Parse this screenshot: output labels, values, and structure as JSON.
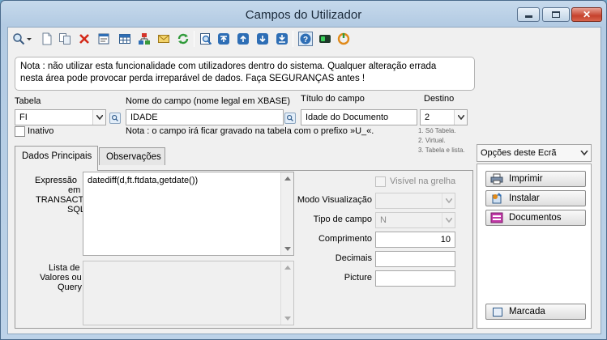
{
  "window": {
    "title": "Campos do Utilizador"
  },
  "toolbar": {
    "icons": [
      "search-icon",
      "new-icon",
      "copy-icon",
      "delete-icon",
      "properties-icon",
      "grid-icon",
      "hierarchy-icon",
      "envelope-icon",
      "refresh-icon",
      "preview-icon",
      "first-icon",
      "previous-icon",
      "next-icon",
      "last-icon",
      "help-icon",
      "toggle-icon",
      "exit-icon"
    ]
  },
  "note": {
    "line1": "Nota : não utilizar esta funcionalidade com utilizadores dentro do sistema. Qualquer alteração errada",
    "line2": "nesta área pode provocar perda irreparável de dados. Faça SEGURANÇAS antes !"
  },
  "form": {
    "tabela_label": "Tabela",
    "tabela_value": "FI",
    "inativo_label": "Inativo",
    "nome_label": "Nome do campo (nome legal em XBASE)",
    "nome_value": "IDADE",
    "titulo_label": "Título do campo",
    "titulo_value": "Idade do Documento",
    "destino_label": "Destino",
    "destino_value": "2",
    "destino_hint1": "1. Só Tabela.",
    "destino_hint2": "2. Virtual.",
    "destino_hint3": "3. Tabela e lista.",
    "prefix_note": "Nota : o campo irá ficar gravado na tabela com o prefixo »U_«."
  },
  "tabs": [
    {
      "label": "Dados Principais"
    },
    {
      "label": "Observações"
    }
  ],
  "main": {
    "expressao_label_1": "Expressão",
    "expressao_label_2": "em",
    "expressao_label_3": "TRANSACT",
    "expressao_label_4": "SQL",
    "expressao_value": "datediff(d,ft.ftdata,getdate())",
    "lista_label_1": "Lista de",
    "lista_label_2": "Valores ou",
    "lista_label_3": "Query",
    "visivel_label": "Visível na grelha",
    "modo_label": "Modo Visualização",
    "modo_value": "",
    "tipo_label": "Tipo de campo",
    "tipo_value": "N",
    "comprimento_label": "Comprimento",
    "comprimento_value": "10",
    "decimais_label": "Decimais",
    "decimais_value": "",
    "picture_label": "Picture",
    "picture_value": ""
  },
  "sidepanel": {
    "title": "Opções deste Ecrã",
    "buttons": [
      {
        "label": "Imprimir",
        "icon": "printer-icon"
      },
      {
        "label": "Instalar",
        "icon": "install-icon"
      },
      {
        "label": "Documentos",
        "icon": "documents-icon"
      }
    ],
    "marcada_label": "Marcada"
  },
  "colors": {
    "accent": "#2e6eb5",
    "frame": "#bcd2e8",
    "close": "#c6412c"
  }
}
